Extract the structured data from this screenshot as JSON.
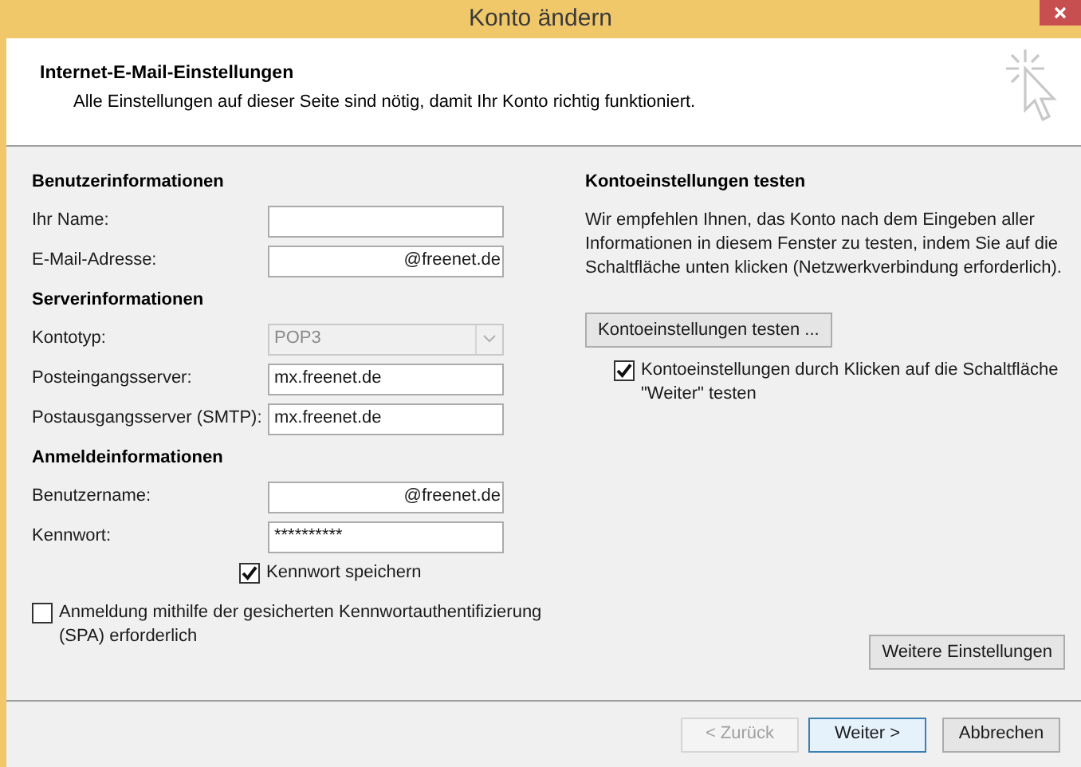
{
  "window": {
    "title": "Konto ändern"
  },
  "header": {
    "title": "Internet-E-Mail-Einstellungen",
    "subtitle": "Alle Einstellungen auf dieser Seite sind nötig, damit Ihr Konto richtig funktioniert."
  },
  "sections": [
    {
      "heading": "Benutzerinformationen",
      "fields": [
        {
          "label": "Ihr Name:",
          "kind": "text",
          "disabled": false
        },
        {
          "label": "E-Mail-Adresse:",
          "value": "@freenet.de",
          "kind": "redacted",
          "disabled": false
        }
      ]
    },
    {
      "heading": "Serverinformationen",
      "fields": [
        {
          "label": "Kontotyp:",
          "value": "POP3",
          "kind": "combo",
          "disabled": true
        },
        {
          "label": "Posteingangsserver:",
          "value": "mx.freenet.de",
          "kind": "text",
          "disabled": false
        },
        {
          "label": "Postausgangsserver (SMTP):",
          "value": "mx.freenet.de",
          "kind": "text",
          "disabled": false
        }
      ]
    },
    {
      "heading": "Anmeldeinformationen",
      "fields": [
        {
          "label": "Benutzername:",
          "value": "@freenet.de",
          "kind": "redacted",
          "disabled": false
        },
        {
          "label": "Kennwort:",
          "value": "**********",
          "kind": "text",
          "disabled": false
        }
      ]
    }
  ],
  "save_password": {
    "label": "Kennwort speichern",
    "checked": true
  },
  "spa": {
    "label": "Anmeldung mithilfe der gesicherten Kennwortauthentifizierung (SPA) erforderlich",
    "checked": false
  },
  "test": {
    "heading": "Kontoeinstellungen testen",
    "description": "Wir empfehlen Ihnen, das Konto nach dem Eingeben aller Informationen in diesem Fenster zu testen, indem Sie auf die Schaltfläche unten klicken (Netzwerkverbindung erforderlich).",
    "button": "Kontoeinstellungen testen ...",
    "test_on_next": {
      "label": "Kontoeinstellungen durch Klicken auf die Schaltfläche \"Weiter\" testen",
      "checked": true
    }
  },
  "more_settings_button": "Weitere Einstellungen",
  "buttons": [
    {
      "label": "< Zurück",
      "disabled": true,
      "default": false
    },
    {
      "label": "Weiter >",
      "disabled": false,
      "default": true
    },
    {
      "label": "Abbrechen",
      "disabled": false,
      "default": false
    }
  ]
}
